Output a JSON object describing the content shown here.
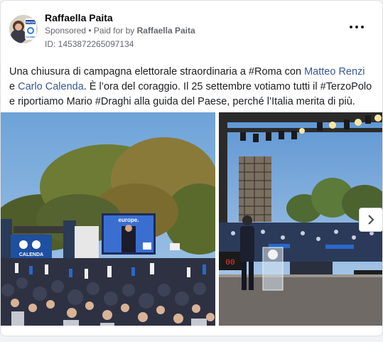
{
  "post": {
    "author_name": "Raffaella Paita",
    "sponsored_label": "Sponsored",
    "separator": " • ",
    "paid_for_label": "Paid for by ",
    "paid_for_name": "Raffaella Paita",
    "id_text": "ID: 1453872265097134",
    "more_icon": "more-horizontal-icon",
    "avatar_badge": "PAITA",
    "avatar_badge_sub": "CALENDA",
    "body": {
      "part1": "Una chiusura di campagna elettorale straordinaria a #Roma con ",
      "link1": "Matteo Renzi",
      "part2": " e ",
      "link2": "Carlo Calenda",
      "part3": ". È l’ora del coraggio. Il 25 settembre votiamo tutti il #TerzoPolo e riportiamo Mario #Draghi alla guida del Paese, perché l’Italia merita di più."
    }
  },
  "photos": {
    "screen_text": "europe.",
    "banner_text": "CALENDA",
    "stage_display": "00"
  },
  "carousel": {
    "next_icon": "chevron-right-icon"
  },
  "colors": {
    "link": "#385898",
    "secondary_text": "#65676b",
    "sky": "#7fb0df",
    "trees": "#6b7a3a",
    "stage_blue": "#1f4fa0"
  }
}
